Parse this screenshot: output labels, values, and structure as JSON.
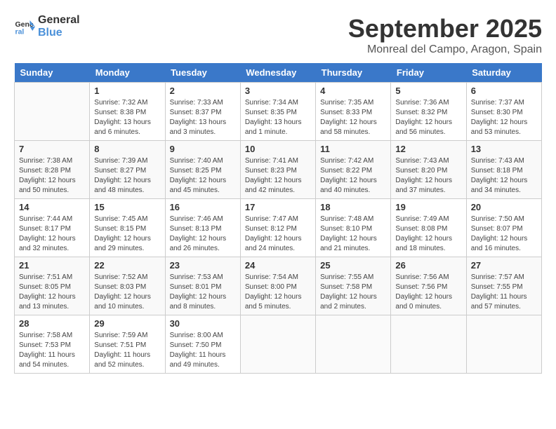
{
  "logo": {
    "line1": "General",
    "line2": "Blue"
  },
  "title": "September 2025",
  "subtitle": "Monreal del Campo, Aragon, Spain",
  "days_of_week": [
    "Sunday",
    "Monday",
    "Tuesday",
    "Wednesday",
    "Thursday",
    "Friday",
    "Saturday"
  ],
  "weeks": [
    [
      {
        "day": "",
        "info": ""
      },
      {
        "day": "1",
        "info": "Sunrise: 7:32 AM\nSunset: 8:38 PM\nDaylight: 13 hours\nand 6 minutes."
      },
      {
        "day": "2",
        "info": "Sunrise: 7:33 AM\nSunset: 8:37 PM\nDaylight: 13 hours\nand 3 minutes."
      },
      {
        "day": "3",
        "info": "Sunrise: 7:34 AM\nSunset: 8:35 PM\nDaylight: 13 hours\nand 1 minute."
      },
      {
        "day": "4",
        "info": "Sunrise: 7:35 AM\nSunset: 8:33 PM\nDaylight: 12 hours\nand 58 minutes."
      },
      {
        "day": "5",
        "info": "Sunrise: 7:36 AM\nSunset: 8:32 PM\nDaylight: 12 hours\nand 56 minutes."
      },
      {
        "day": "6",
        "info": "Sunrise: 7:37 AM\nSunset: 8:30 PM\nDaylight: 12 hours\nand 53 minutes."
      }
    ],
    [
      {
        "day": "7",
        "info": "Sunrise: 7:38 AM\nSunset: 8:28 PM\nDaylight: 12 hours\nand 50 minutes."
      },
      {
        "day": "8",
        "info": "Sunrise: 7:39 AM\nSunset: 8:27 PM\nDaylight: 12 hours\nand 48 minutes."
      },
      {
        "day": "9",
        "info": "Sunrise: 7:40 AM\nSunset: 8:25 PM\nDaylight: 12 hours\nand 45 minutes."
      },
      {
        "day": "10",
        "info": "Sunrise: 7:41 AM\nSunset: 8:23 PM\nDaylight: 12 hours\nand 42 minutes."
      },
      {
        "day": "11",
        "info": "Sunrise: 7:42 AM\nSunset: 8:22 PM\nDaylight: 12 hours\nand 40 minutes."
      },
      {
        "day": "12",
        "info": "Sunrise: 7:43 AM\nSunset: 8:20 PM\nDaylight: 12 hours\nand 37 minutes."
      },
      {
        "day": "13",
        "info": "Sunrise: 7:43 AM\nSunset: 8:18 PM\nDaylight: 12 hours\nand 34 minutes."
      }
    ],
    [
      {
        "day": "14",
        "info": "Sunrise: 7:44 AM\nSunset: 8:17 PM\nDaylight: 12 hours\nand 32 minutes."
      },
      {
        "day": "15",
        "info": "Sunrise: 7:45 AM\nSunset: 8:15 PM\nDaylight: 12 hours\nand 29 minutes."
      },
      {
        "day": "16",
        "info": "Sunrise: 7:46 AM\nSunset: 8:13 PM\nDaylight: 12 hours\nand 26 minutes."
      },
      {
        "day": "17",
        "info": "Sunrise: 7:47 AM\nSunset: 8:12 PM\nDaylight: 12 hours\nand 24 minutes."
      },
      {
        "day": "18",
        "info": "Sunrise: 7:48 AM\nSunset: 8:10 PM\nDaylight: 12 hours\nand 21 minutes."
      },
      {
        "day": "19",
        "info": "Sunrise: 7:49 AM\nSunset: 8:08 PM\nDaylight: 12 hours\nand 18 minutes."
      },
      {
        "day": "20",
        "info": "Sunrise: 7:50 AM\nSunset: 8:07 PM\nDaylight: 12 hours\nand 16 minutes."
      }
    ],
    [
      {
        "day": "21",
        "info": "Sunrise: 7:51 AM\nSunset: 8:05 PM\nDaylight: 12 hours\nand 13 minutes."
      },
      {
        "day": "22",
        "info": "Sunrise: 7:52 AM\nSunset: 8:03 PM\nDaylight: 12 hours\nand 10 minutes."
      },
      {
        "day": "23",
        "info": "Sunrise: 7:53 AM\nSunset: 8:01 PM\nDaylight: 12 hours\nand 8 minutes."
      },
      {
        "day": "24",
        "info": "Sunrise: 7:54 AM\nSunset: 8:00 PM\nDaylight: 12 hours\nand 5 minutes."
      },
      {
        "day": "25",
        "info": "Sunrise: 7:55 AM\nSunset: 7:58 PM\nDaylight: 12 hours\nand 2 minutes."
      },
      {
        "day": "26",
        "info": "Sunrise: 7:56 AM\nSunset: 7:56 PM\nDaylight: 12 hours\nand 0 minutes."
      },
      {
        "day": "27",
        "info": "Sunrise: 7:57 AM\nSunset: 7:55 PM\nDaylight: 11 hours\nand 57 minutes."
      }
    ],
    [
      {
        "day": "28",
        "info": "Sunrise: 7:58 AM\nSunset: 7:53 PM\nDaylight: 11 hours\nand 54 minutes."
      },
      {
        "day": "29",
        "info": "Sunrise: 7:59 AM\nSunset: 7:51 PM\nDaylight: 11 hours\nand 52 minutes."
      },
      {
        "day": "30",
        "info": "Sunrise: 8:00 AM\nSunset: 7:50 PM\nDaylight: 11 hours\nand 49 minutes."
      },
      {
        "day": "",
        "info": ""
      },
      {
        "day": "",
        "info": ""
      },
      {
        "day": "",
        "info": ""
      },
      {
        "day": "",
        "info": ""
      }
    ]
  ]
}
